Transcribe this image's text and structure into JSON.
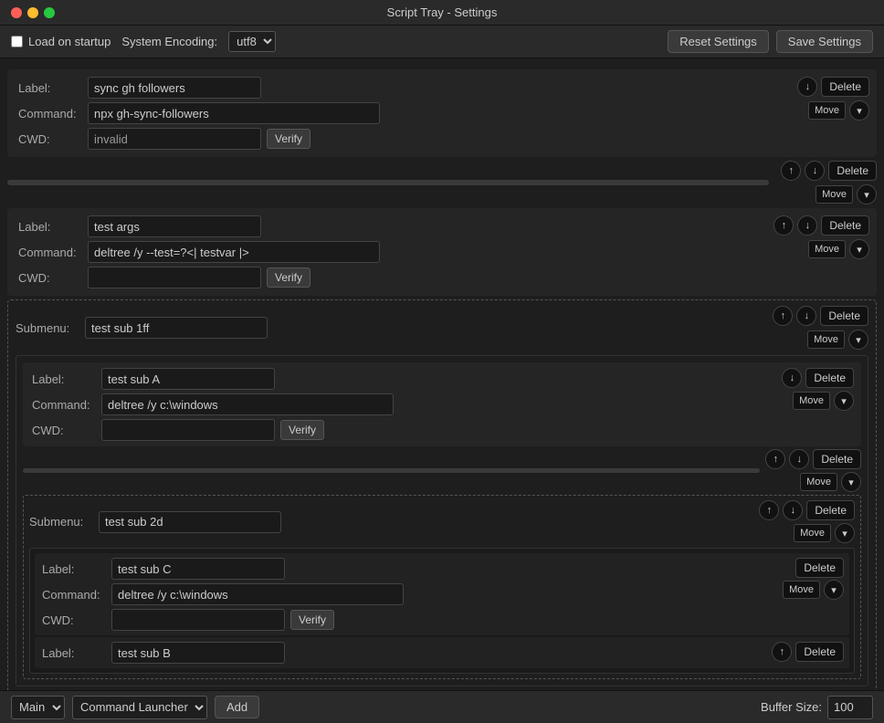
{
  "window": {
    "title": "Script Tray - Settings"
  },
  "toolbar": {
    "load_on_startup_label": "Load on startup",
    "encoding_label": "System Encoding:",
    "encoding_value": "utf8",
    "reset_label": "Reset Settings",
    "save_label": "Save Settings"
  },
  "entries": [
    {
      "type": "command",
      "label": "sync gh followers",
      "command": "npx gh-sync-followers",
      "cwd": "invalid",
      "cwd_invalid": true
    },
    {
      "type": "separator"
    },
    {
      "type": "command",
      "label": "test args",
      "command": "deltree /y --test=?<| testvar |>",
      "cwd": ""
    },
    {
      "type": "submenu",
      "label": "test sub 1ff",
      "children": [
        {
          "type": "command",
          "label": "test sub A",
          "command": "deltree /y c:\\windows",
          "cwd": ""
        },
        {
          "type": "separator"
        },
        {
          "type": "submenu",
          "label": "test sub 2d",
          "children": [
            {
              "type": "command",
              "label": "test sub C",
              "command": "deltree /y c:\\windows",
              "cwd": ""
            },
            {
              "type": "command",
              "label": "test sub B",
              "command": "",
              "cwd": ""
            }
          ]
        }
      ]
    }
  ],
  "bottom": {
    "main_label": "Main",
    "launcher_label": "Command Launcher",
    "add_label": "Add",
    "buffer_label": "Buffer Size:",
    "buffer_value": "100"
  },
  "labels": {
    "label": "Label:",
    "command": "Command:",
    "cwd": "CWD:",
    "submenu": "Submenu:",
    "verify": "Verify",
    "delete": "Delete",
    "move": "Move",
    "up": "↑",
    "down": "↓",
    "chevron_down": "▾"
  }
}
